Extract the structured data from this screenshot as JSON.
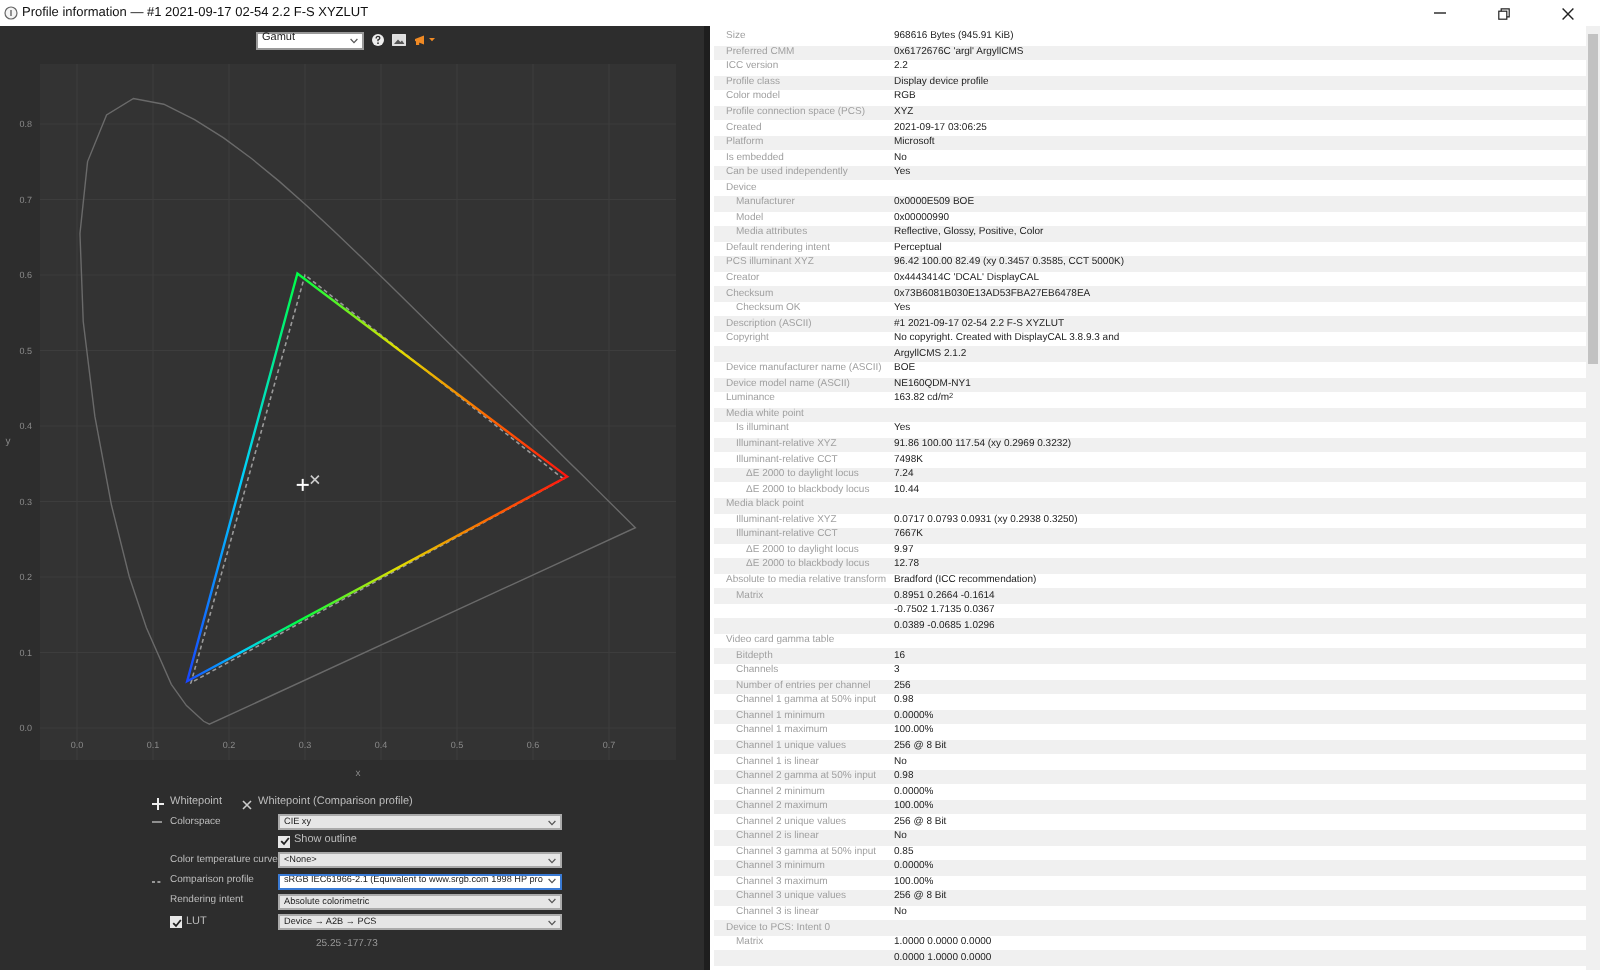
{
  "window": {
    "title": "Profile information — #1 2021-09-17 02-54 2.2 F-S XYZLUT"
  },
  "toolbar": {
    "view_select": "Gamut"
  },
  "gamut_plot": {
    "x_axis_label": "x",
    "y_axis_label": "y",
    "x_tick_labels": [
      "0.0",
      "0.1",
      "0.2",
      "0.3",
      "0.4",
      "0.5",
      "0.6",
      "0.7"
    ],
    "y_tick_labels": [
      "0.8",
      "0.7",
      "0.6",
      "0.5",
      "0.4",
      "0.3",
      "0.2",
      "0.1",
      "0.0"
    ]
  },
  "legend": [
    {
      "kind": "plus",
      "label": "Whitepoint"
    },
    {
      "kind": "cross",
      "label": "Whitepoint (Comparison profile)"
    }
  ],
  "controls": [
    {
      "kind": "select",
      "sample": {
        "kind": "solid"
      },
      "label": "Colorspace",
      "value": "CIE xy",
      "focused": false
    },
    {
      "kind": "checkbox",
      "label": "Show outline",
      "checked": true
    },
    {
      "kind": "select",
      "label": "Color temperature curve",
      "value": "<None>",
      "focused": false
    },
    {
      "kind": "select",
      "sample": {
        "kind": "dashed"
      },
      "label": "Comparison profile",
      "value": "sRGB IEC61966-2.1 (Equivalent to www.srgb.com 1998 HP pro",
      "focused": true
    },
    {
      "kind": "select",
      "label": "Rendering intent",
      "value": "Absolute colorimetric",
      "focused": false
    },
    {
      "kind": "checkbox_select",
      "label": "LUT",
      "checked": true,
      "value": "Device → A2B → PCS",
      "focused": false
    }
  ],
  "coordinates": "25.25 -177.73",
  "properties": [
    {
      "label": "Size",
      "value": "968616 Bytes (945.91 KiB)"
    },
    {
      "label": "Preferred CMM",
      "value": "0x6172676C 'argl' ArgyllCMS"
    },
    {
      "label": "ICC version",
      "value": "2.2"
    },
    {
      "label": "Profile class",
      "value": "Display device profile"
    },
    {
      "label": "Color model",
      "value": "RGB"
    },
    {
      "label": "Profile connection space (PCS)",
      "value": "XYZ"
    },
    {
      "label": "Created",
      "value": "2021-09-17 03:06:25"
    },
    {
      "label": "Platform",
      "value": "Microsoft"
    },
    {
      "label": "Is embedded",
      "value": "No"
    },
    {
      "label": "Can be used independently",
      "value": "Yes"
    },
    {
      "label": "Device",
      "children": [
        {
          "label": "Manufacturer",
          "value": "0x0000E509 BOE"
        },
        {
          "label": "Model",
          "value": "0x00000990"
        },
        {
          "label": "Media attributes",
          "value": "Reflective, Glossy, Positive, Color"
        }
      ]
    },
    {
      "label": "Default rendering intent",
      "value": "Perceptual"
    },
    {
      "label": "PCS illuminant XYZ",
      "value": "96.42 100.00  82.49 (xy 0.3457 0.3585, CCT 5000K)"
    },
    {
      "label": "Creator",
      "value": "0x4443414C 'DCAL' DisplayCAL"
    },
    {
      "label": "Checksum",
      "value": "0x73B6081B030E13AD53FBA27EB6478EA",
      "children": [
        {
          "label": "Checksum OK",
          "value": "Yes"
        }
      ]
    },
    {
      "label": "Description (ASCII)",
      "value": "#1 2021-09-17 02-54 2.2 F-S XYZLUT"
    },
    {
      "label": "Copyright",
      "lines": [
        "No copyright. Created with DisplayCAL 3.8.9.3 and",
        "ArgyllCMS 2.1.2"
      ]
    },
    {
      "label": "Device manufacturer name (ASCII)",
      "value": "BOE"
    },
    {
      "label": "Device model name (ASCII)",
      "value": "NE160QDM-NY1"
    },
    {
      "label": "Luminance",
      "value": "163.82 cd/m$^{2}$"
    },
    {
      "label": "Media white point",
      "children": [
        {
          "label": "Is illuminant",
          "value": "Yes"
        },
        {
          "label": "Illuminant-relative XYZ",
          "value": "91.86 100.00 117.54 (xy 0.2969 0.3232)"
        },
        {
          "label": "Illuminant-relative CCT",
          "value": "7498K",
          "children": [
            {
              "label": "ΔE 2000 to daylight locus",
              "value": "7.24"
            },
            {
              "label": "ΔE 2000 to blackbody locus",
              "value": "10.44"
            }
          ]
        }
      ]
    },
    {
      "label": "Media black point",
      "children": [
        {
          "label": "Illuminant-relative XYZ",
          "value": "0.0717 0.0793 0.0931 (xy 0.2938 0.3250)"
        },
        {
          "label": "Illuminant-relative CCT",
          "value": "7667K",
          "children": [
            {
              "label": "ΔE 2000 to daylight locus",
              "value": "9.97"
            },
            {
              "label": "ΔE 2000 to blackbody locus",
              "value": "12.78"
            }
          ]
        }
      ]
    },
    {
      "label": "Absolute to media relative transform",
      "value": "Bradford (ICC recommendation)",
      "children": [
        {
          "label": "Matrix",
          "lines": [
            "0.8951 0.2664 -0.1614",
            "-0.7502 1.7135 0.0367",
            "0.0389 -0.0685 1.0296"
          ]
        }
      ]
    },
    {
      "label": "Video card gamma table",
      "children": [
        {
          "label": "Bitdepth",
          "value": "16"
        },
        {
          "label": "Channels",
          "value": "3"
        },
        {
          "label": "Number of entries per channel",
          "value": "256"
        },
        {
          "label": "Channel 1 gamma at 50% input",
          "value": "0.98"
        },
        {
          "label": "Channel 1 minimum",
          "value": "0.0000%"
        },
        {
          "label": "Channel 1 maximum",
          "value": "100.00%"
        },
        {
          "label": "Channel 1 unique values",
          "value": "256 @ 8 Bit"
        },
        {
          "label": "Channel 1 is linear",
          "value": "No"
        },
        {
          "label": "Channel 2 gamma at 50% input",
          "value": "0.98"
        },
        {
          "label": "Channel 2 minimum",
          "value": "0.0000%"
        },
        {
          "label": "Channel 2 maximum",
          "value": "100.00%"
        },
        {
          "label": "Channel 2 unique values",
          "value": "256 @ 8 Bit"
        },
        {
          "label": "Channel 2 is linear",
          "value": "No"
        },
        {
          "label": "Channel 3 gamma at 50% input",
          "value": "0.85"
        },
        {
          "label": "Channel 3 minimum",
          "value": "0.0000%"
        },
        {
          "label": "Channel 3 maximum",
          "value": "100.00%"
        },
        {
          "label": "Channel 3 unique values",
          "value": "256 @ 8 Bit"
        },
        {
          "label": "Channel 3 is linear",
          "value": "No"
        }
      ]
    },
    {
      "label": "Device to PCS: Intent 0",
      "children": [
        {
          "label": "Matrix",
          "lines": [
            "1.0000 0.0000 0.0000",
            "0.0000 1.0000 0.0000"
          ]
        }
      ]
    }
  ]
}
